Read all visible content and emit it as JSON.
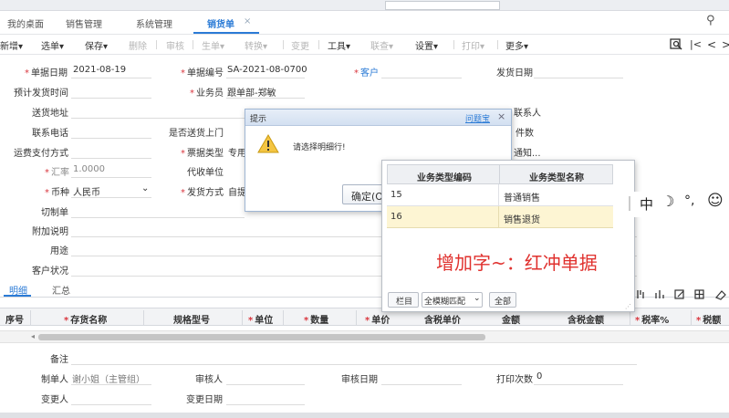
{
  "tabs": [
    {
      "label": "我的桌面"
    },
    {
      "label": "销售管理"
    },
    {
      "label": "系统管理"
    },
    {
      "label": "销货单"
    }
  ],
  "tab_close": "×",
  "search_icon": "⚲",
  "toolbar": [
    "新增",
    "选单",
    "保存",
    "删除",
    "审核",
    "生单",
    "转换",
    "变更",
    "工具",
    "联查",
    "设置",
    "打印",
    "更多"
  ],
  "toolbar_right": {
    "first": "|<",
    "prev": "<",
    "next": ">"
  },
  "form": {
    "doc_date_label": "单据日期",
    "doc_date": "2021-08-19",
    "doc_no_label": "单据编号",
    "doc_no": "SA-2021-08-0700",
    "customer_label": "客户",
    "ship_date_label": "发货日期",
    "plan_ship_label": "预计发货时间",
    "salesman_label": "业务员",
    "salesman": "跟单部-郑敏",
    "ship_addr_label": "送货地址",
    "contact_label": "联系人",
    "phone_label": "联系电话",
    "door_label": "是否送货上门",
    "pieces_label": "件数",
    "freight_label": "运费支付方式",
    "biz_type_label": "票据类型",
    "biz_type": "专用",
    "notice_label": "通知...",
    "rate_label": "汇率",
    "rate": "1.0000",
    "collect_label": "代收单位",
    "currency_label": "币种",
    "currency": "人民币",
    "send_label": "发货方式",
    "send": "自提",
    "cut_label": "切制单",
    "note_label": "附加说明",
    "use_label": "用途",
    "cust_status_label": "客户状况"
  },
  "subtabs": [
    "明细",
    "汇总"
  ],
  "table_headers": [
    "序号",
    "存货名称",
    "规格型号",
    "单位",
    "数量",
    "单价",
    "含税单价",
    "金额",
    "含税金额",
    "税率%",
    "税额"
  ],
  "footer": {
    "remark_label": "备注",
    "maker_label": "制单人",
    "maker": "谢小姐（主管组）",
    "auditor_label": "审核人",
    "audit_date_label": "审核日期",
    "print_label": "打印次数",
    "print_count": "0",
    "changer_label": "变更人",
    "change_date_label": "变更日期"
  },
  "dialog": {
    "title": "提示",
    "link": "问题宝",
    "close": "×",
    "message": "请选择明细行!",
    "confirm": "确定(O)"
  },
  "popup": {
    "headers": [
      "业务类型编码",
      "业务类型名称"
    ],
    "rows": [
      {
        "code": "15",
        "name": "普通销售"
      },
      {
        "code": "16",
        "name": "销售退货"
      }
    ],
    "annotation": "增加字~：红冲单据",
    "btn_col": "栏目",
    "match_mode": "全模糊匹配",
    "btn_all": "全部"
  },
  "ime": {
    "mode": "中",
    "moon": "☽",
    "punct": "°,",
    "emoji": "☺"
  },
  "colors": {
    "accent": "#2b7bd6",
    "required": "#d9363e",
    "annotation": "#e0312e",
    "selected_row": "#fdf5d3"
  }
}
